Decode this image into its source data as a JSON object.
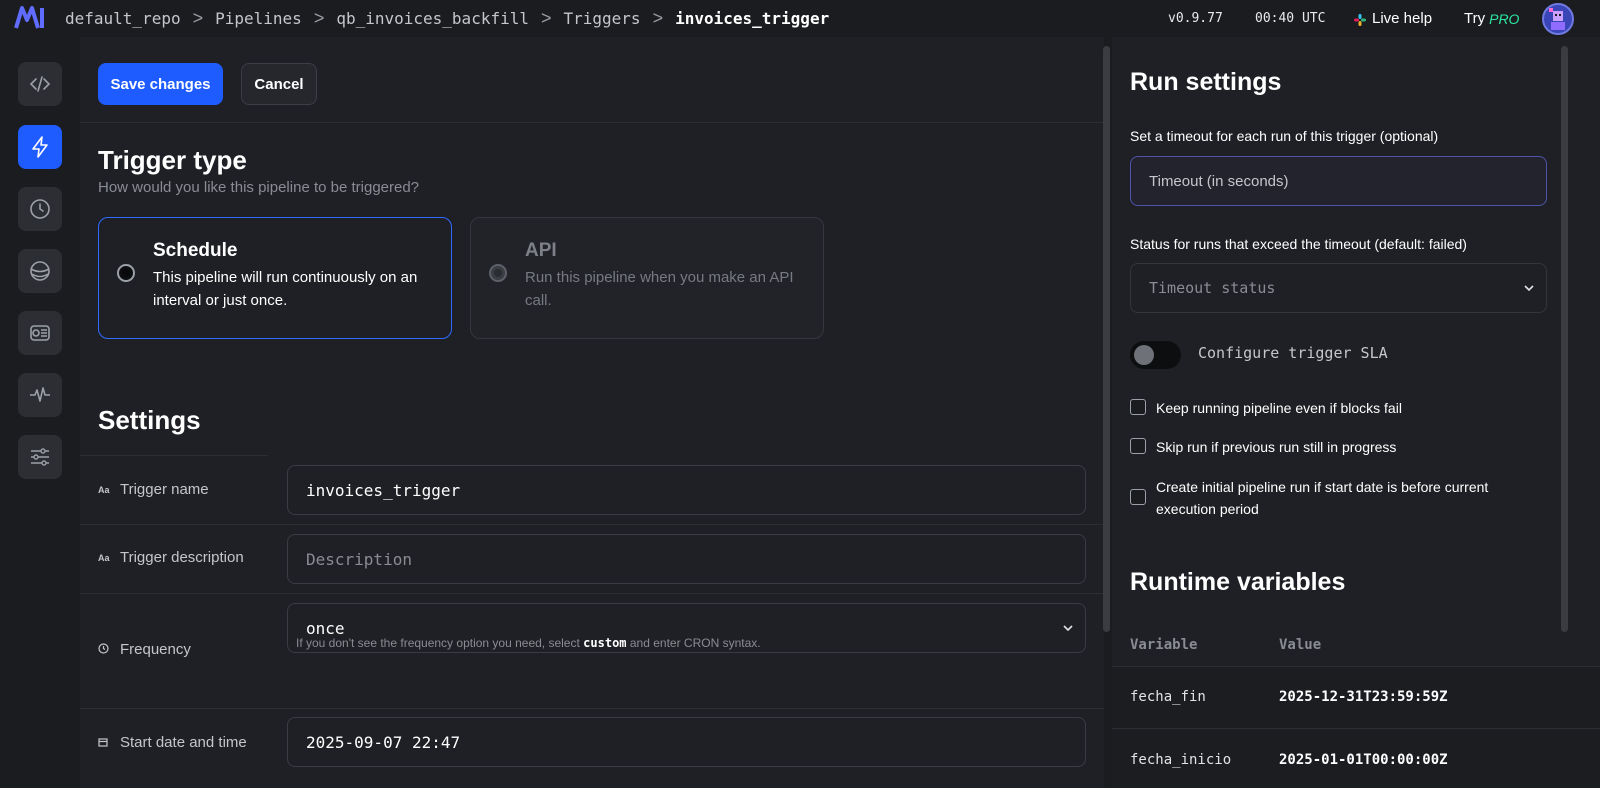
{
  "header": {
    "breadcrumbs": [
      "default_repo",
      "Pipelines",
      "qb_invoices_backfill",
      "Triggers",
      "invoices_trigger"
    ],
    "separator": ">",
    "version": "v0.9.77",
    "time": "00:40 UTC",
    "live_help": "Live help",
    "try_label": "Try",
    "pro_label": "PRO"
  },
  "sidebar": {
    "items": [
      {
        "icon": "code-icon"
      },
      {
        "icon": "lightning-icon",
        "active": true
      },
      {
        "icon": "clock-icon"
      },
      {
        "icon": "globe-icon"
      },
      {
        "icon": "block-icon"
      },
      {
        "icon": "pulse-icon"
      },
      {
        "icon": "sliders-icon"
      }
    ]
  },
  "toolbar": {
    "save_label": "Save changes",
    "cancel_label": "Cancel"
  },
  "trigger_type": {
    "title": "Trigger type",
    "subtitle": "How would you like this pipeline to be triggered?",
    "options": [
      {
        "title": "Schedule",
        "description": "This pipeline will run continuously on an interval or just once.",
        "selected": true
      },
      {
        "title": "API",
        "description": "Run this pipeline when you make an API call.",
        "selected": false
      }
    ]
  },
  "settings": {
    "title": "Settings",
    "trigger_name": {
      "label": "Trigger name",
      "value": "invoices_trigger"
    },
    "trigger_description": {
      "label": "Trigger description",
      "placeholder": "Description"
    },
    "frequency": {
      "label": "Frequency",
      "value": "once"
    },
    "hint_before": "If you don't see the frequency option you need, select",
    "hint_code": "custom",
    "hint_after": "and enter CRON syntax.",
    "start_date": {
      "label": "Start date and time",
      "value": "2025-09-07 22:47"
    }
  },
  "run_settings": {
    "title": "Run settings",
    "timeout_label": "Set a timeout for each run of this trigger (optional)",
    "timeout_placeholder": "Timeout (in seconds)",
    "status_label": "Status for runs that exceed the timeout (default: failed)",
    "status_placeholder": "Timeout status",
    "sla_label": "Configure trigger SLA",
    "checkboxes": [
      "Keep running pipeline even if blocks fail",
      "Skip run if previous run still in progress",
      "Create initial pipeline run if start date is before current execution period"
    ]
  },
  "runtime_variables": {
    "title": "Runtime variables",
    "columns": [
      "Variable",
      "Value"
    ],
    "rows": [
      {
        "variable": "fecha_fin",
        "value": "2025-12-31T23:59:59Z"
      },
      {
        "variable": "fecha_inicio",
        "value": "2025-01-01T00:00:00Z"
      }
    ]
  },
  "colors": {
    "accent": "#1f5cff",
    "pro": "#2ee6a0",
    "background": "#1f2025"
  }
}
